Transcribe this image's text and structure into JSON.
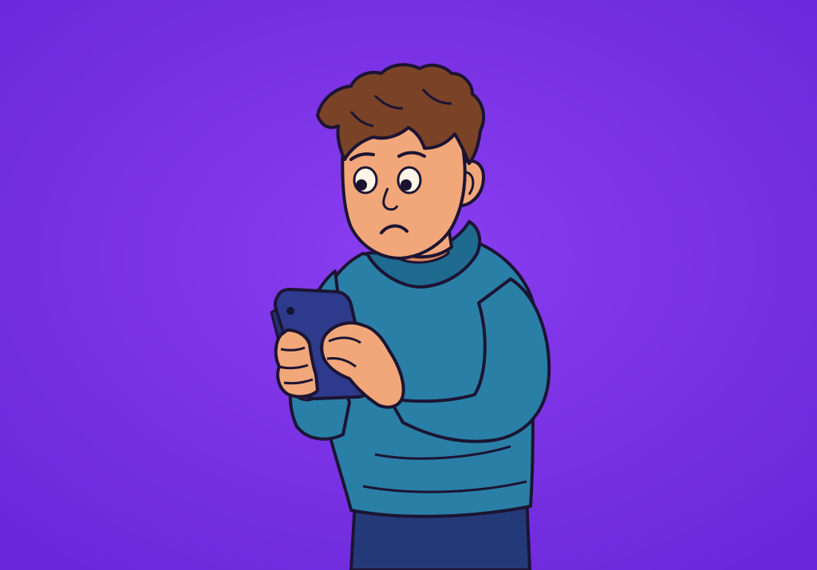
{
  "scene": {
    "subject": "person-looking-at-phone",
    "expression": "worried-frown"
  },
  "colors": {
    "background_center": "#8a3ef0",
    "background_edge": "#6a27d9",
    "outline": "#1c1433",
    "hair": "#7a4327",
    "hair_shade": "#5a2f1b",
    "skin": "#f2a77a",
    "skin_shade": "#d9865d",
    "eye_white": "#fff6e8",
    "pupil": "#1a1430",
    "hoodie": "#2a7fa6",
    "hoodie_shade": "#1f6a8f",
    "phone": "#2e3a8c",
    "phone_shade": "#252f75",
    "pants": "#243a78"
  },
  "icons": [
    "phone-icon"
  ]
}
